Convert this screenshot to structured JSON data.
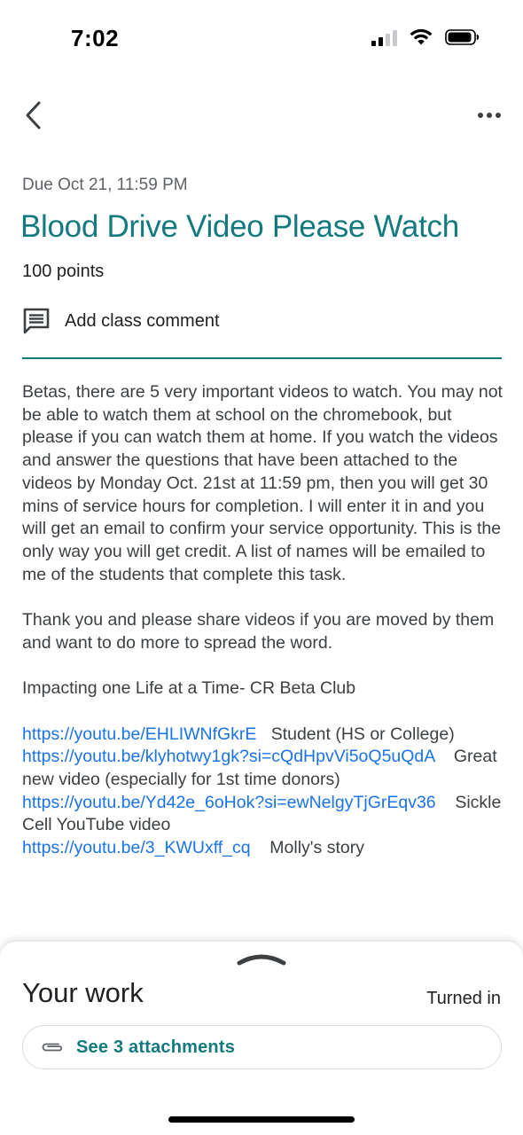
{
  "status_bar": {
    "time": "7:02",
    "signal_icon": "cellular-signal-icon",
    "wifi_icon": "wifi-icon",
    "battery_icon": "battery-icon"
  },
  "topbar": {
    "back_icon": "chevron-left-icon",
    "more_icon": "more-horizontal-icon"
  },
  "assignment": {
    "due": "Due Oct 21, 11:59 PM",
    "title": "Blood Drive Video Please Watch",
    "points": "100 points",
    "comment_label": "Add class comment",
    "accent_color": "#137a7f"
  },
  "description": {
    "p1": "Betas, there are 5 very important videos to watch. You may not be able to watch them at school on the chromebook, but please if you can watch them at home. If you watch the videos and answer the questions that have been attached to the videos by Monday Oct. 21st at 11:59 pm, then you will get 30 mins of service hours for completion. I will enter it in and you will get an email to confirm your service opportunity. This is the only way you will get credit. A list of names will be emailed to me of the students that complete this task.",
    "p2": "Thank you and please share videos if you are moved by them and want to do more to spread the word.",
    "p3": "Impacting one Life at a Time- CR Beta Club",
    "links": [
      {
        "url": "https://youtu.be/EHLIWNfGkrE",
        "text": "   Student (HS or College)"
      },
      {
        "url": "https://youtu.be/klyhotwy1gk?si=cQdHpvVi5oQ5uQdA",
        "text": "    Great new video (especially for 1st time donors)"
      },
      {
        "url": "https://youtu.be/Yd42e_6oHok?si=ewNelgyTjGrEqv36",
        "text": "    Sickle Cell YouTube video"
      },
      {
        "url": "https://youtu.be/3_KWUxff_cq",
        "text": "    Molly's story"
      }
    ]
  },
  "your_work": {
    "heading": "Your work",
    "status": "Turned in",
    "attachments_label": "See 3 attachments",
    "attachment_icon": "paperclip-icon",
    "handle_icon": "chevron-up-icon"
  }
}
